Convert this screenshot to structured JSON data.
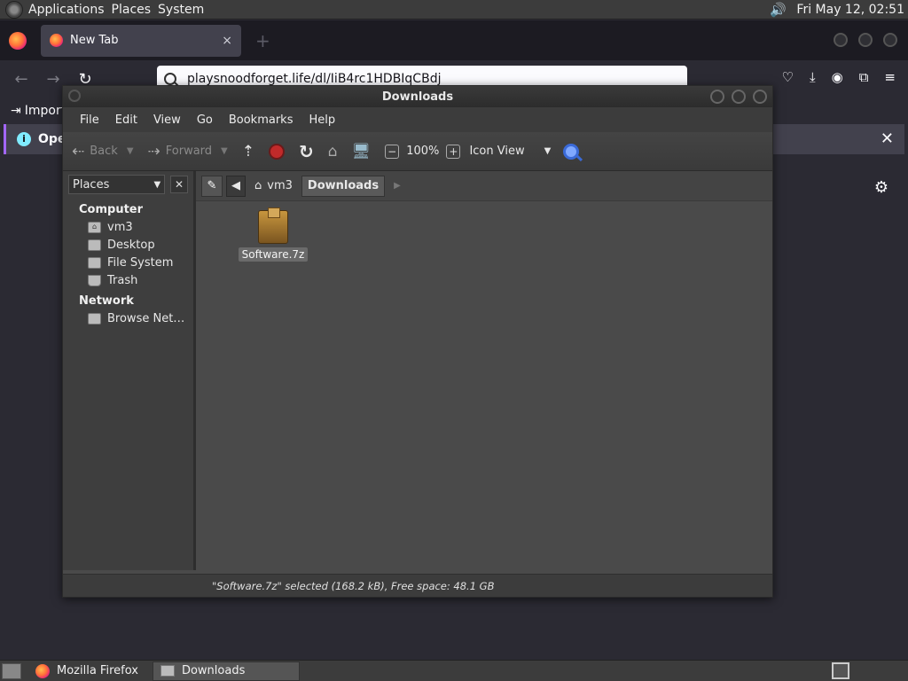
{
  "top_panel": {
    "menus": [
      "Applications",
      "Places",
      "System"
    ],
    "clock": "Fri May 12, 02:51",
    "icons": [
      "gnome-foot-icon",
      "volume-icon"
    ]
  },
  "firefox": {
    "tab_title": "New Tab",
    "tab_close": "×",
    "new_tab": "+",
    "url": "playsnoodforget.life/dl/IiB4rc1HDBIqCBdj",
    "bookmark_item": "Import",
    "infobar_text": "Ope",
    "infobar_close": "✕"
  },
  "file_manager": {
    "title": "Downloads",
    "menu": [
      "File",
      "Edit",
      "View",
      "Go",
      "Bookmarks",
      "Help"
    ],
    "toolbar": {
      "back": "Back",
      "forward": "Forward",
      "zoom": "100%",
      "view_mode": "Icon View"
    },
    "places_label": "Places",
    "sidebar": {
      "computer_header": "Computer",
      "computer_items": [
        "vm3",
        "Desktop",
        "File System",
        "Trash"
      ],
      "network_header": "Network",
      "network_items": [
        "Browse Net…"
      ]
    },
    "path": {
      "home": "vm3",
      "current": "Downloads"
    },
    "files": [
      {
        "name": "Software.7z",
        "icon": "package-icon",
        "selected": true
      }
    ],
    "status": "\"Software.7z\" selected (168.2 kB), Free space: 48.1 GB"
  },
  "taskbar": {
    "items": [
      "Mozilla Firefox",
      "Downloads"
    ]
  },
  "colors": {
    "panel": "#3c3c3c",
    "firefox_bg": "#2b2a33",
    "fm_bg": "#4a4a4a",
    "stop_red": "#c02a2a",
    "search_blue": "#3a6ad8"
  }
}
